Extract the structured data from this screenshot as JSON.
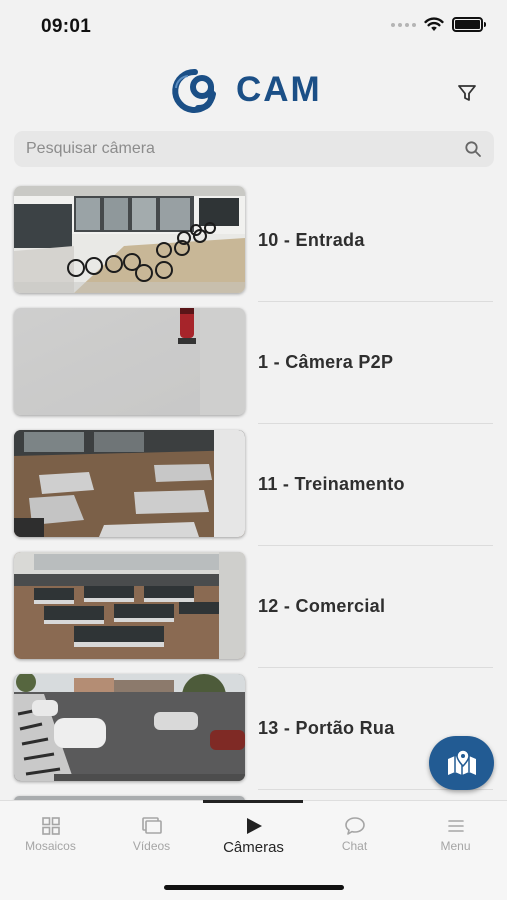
{
  "status_bar": {
    "time": "09:01",
    "icons": [
      "signal-dots-icon",
      "wifi-icon",
      "battery-icon"
    ]
  },
  "header": {
    "logo_text": "CAM",
    "logo_icon": "nine-cam-logo",
    "filter_icon": "filter-funnel-icon",
    "brand_color": "#1b4f86"
  },
  "search": {
    "placeholder": "Pesquisar câmera",
    "value": "",
    "icon": "search-icon"
  },
  "cameras": [
    {
      "label": "10 - Entrada",
      "scene": "bicycles-hallway"
    },
    {
      "label": "1 - Câmera P2P",
      "scene": "wall-fire-extinguisher"
    },
    {
      "label": "11 - Treinamento",
      "scene": "training-room-tables"
    },
    {
      "label": "12 - Comercial",
      "scene": "office-desks"
    },
    {
      "label": "13 - Portão Rua",
      "scene": "street-cars"
    }
  ],
  "fab": {
    "icon": "map-pin-icon",
    "color": "#225b93"
  },
  "tabs": [
    {
      "label": "Mosaicos",
      "icon": "grid-icon",
      "active": false
    },
    {
      "label": "Vídeos",
      "icon": "videos-icon",
      "active": false
    },
    {
      "label": "Câmeras",
      "icon": "play-icon",
      "active": true
    },
    {
      "label": "Chat",
      "icon": "chat-bubble-icon",
      "active": false
    },
    {
      "label": "Menu",
      "icon": "hamburger-menu-icon",
      "active": false
    }
  ]
}
